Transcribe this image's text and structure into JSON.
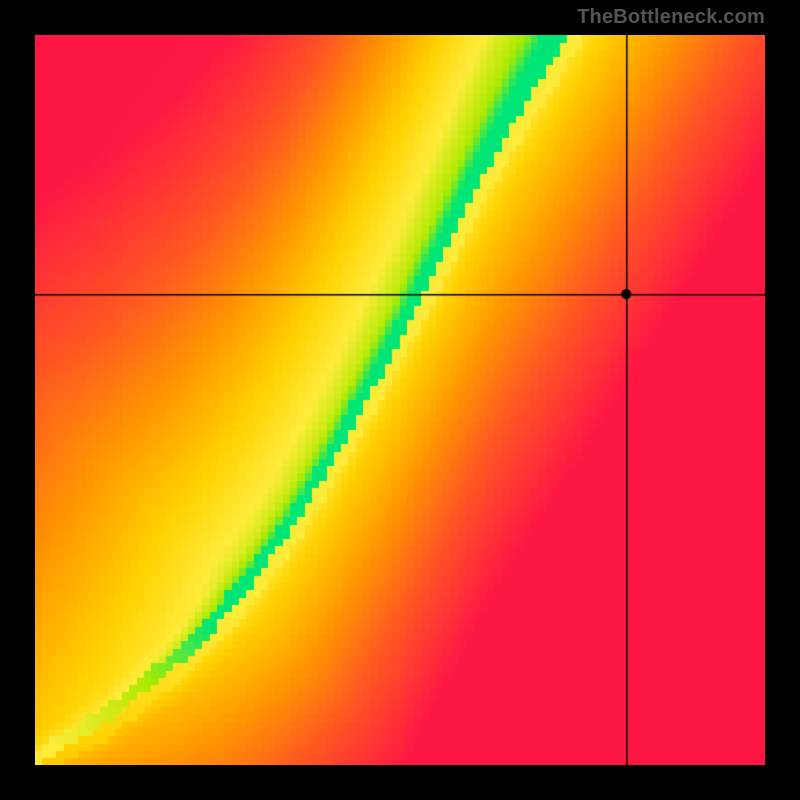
{
  "watermark": "TheBottleneck.com",
  "chart_data": {
    "type": "heatmap",
    "title": "",
    "xlabel": "",
    "ylabel": "",
    "xlim": [
      0,
      1
    ],
    "ylim": [
      0,
      1
    ],
    "grid": false,
    "crosshair": {
      "x": 0.81,
      "y": 0.645
    },
    "marker": {
      "x": 0.81,
      "y": 0.645
    },
    "ridge": {
      "description": "green optimal-match curve; value=1 on ridge, 0 far from it",
      "points": [
        {
          "x": 0.0,
          "y": 0.0
        },
        {
          "x": 0.05,
          "y": 0.03
        },
        {
          "x": 0.1,
          "y": 0.06
        },
        {
          "x": 0.15,
          "y": 0.1
        },
        {
          "x": 0.2,
          "y": 0.14
        },
        {
          "x": 0.25,
          "y": 0.19
        },
        {
          "x": 0.3,
          "y": 0.25
        },
        {
          "x": 0.35,
          "y": 0.32
        },
        {
          "x": 0.4,
          "y": 0.4
        },
        {
          "x": 0.45,
          "y": 0.49
        },
        {
          "x": 0.5,
          "y": 0.58
        },
        {
          "x": 0.55,
          "y": 0.68
        },
        {
          "x": 0.6,
          "y": 0.78
        },
        {
          "x": 0.65,
          "y": 0.87
        },
        {
          "x": 0.7,
          "y": 0.95
        },
        {
          "x": 0.73,
          "y": 1.0
        }
      ]
    },
    "colorscale": [
      {
        "t": 0.0,
        "hex": "#ff1744"
      },
      {
        "t": 0.28,
        "hex": "#ff5722"
      },
      {
        "t": 0.5,
        "hex": "#ff9800"
      },
      {
        "t": 0.7,
        "hex": "#ffd200"
      },
      {
        "t": 0.84,
        "hex": "#ffeb3b"
      },
      {
        "t": 0.93,
        "hex": "#aeea00"
      },
      {
        "t": 1.0,
        "hex": "#00e676"
      }
    ],
    "resolution": 100
  }
}
